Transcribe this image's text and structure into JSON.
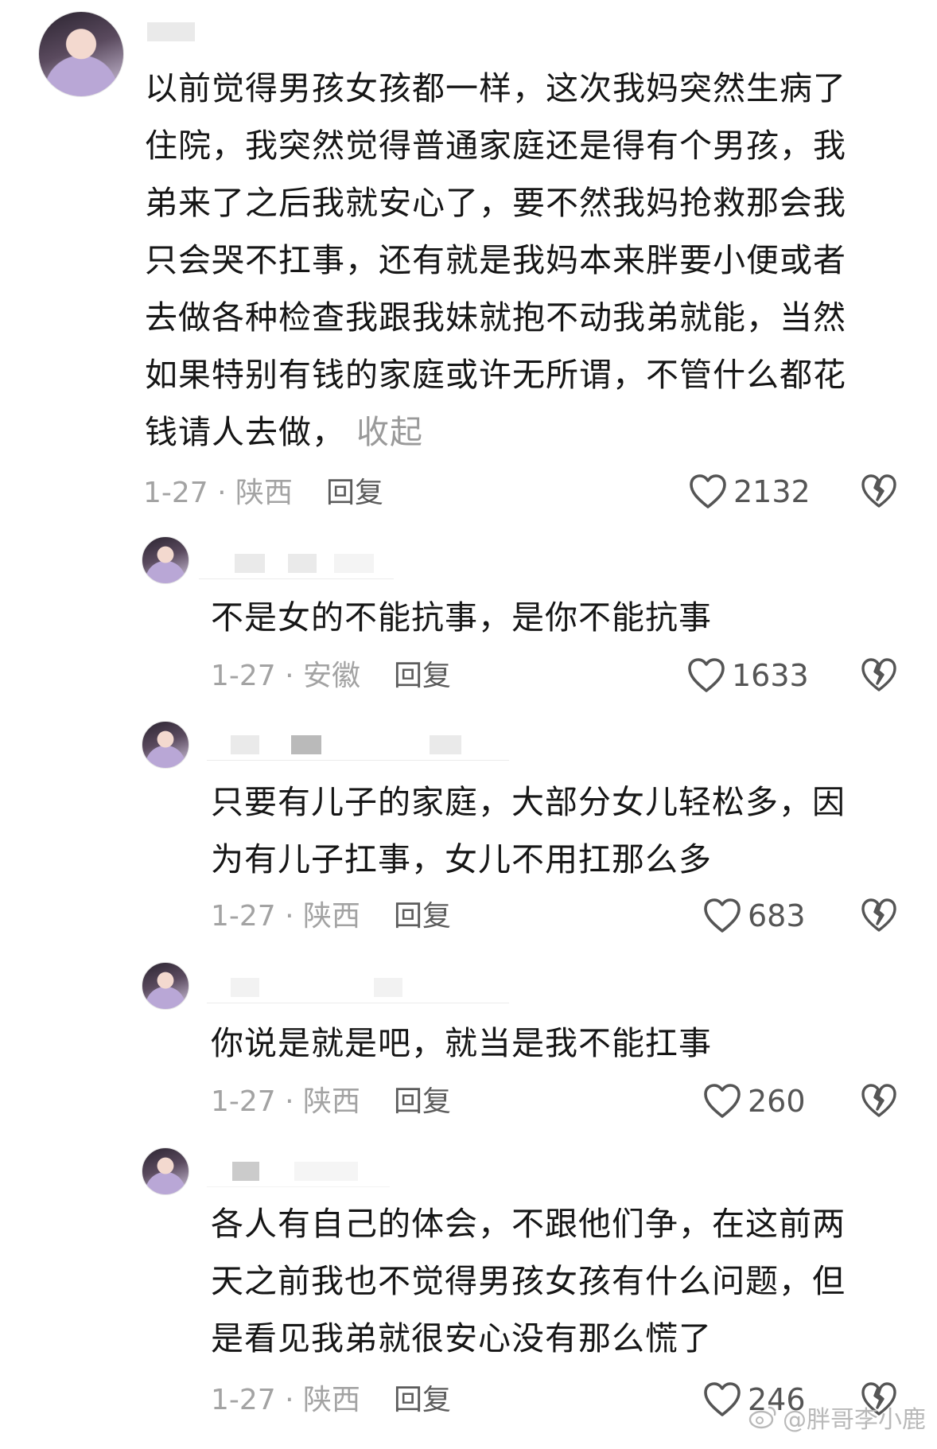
{
  "comments": [
    {
      "text": "以前觉得男孩女孩都一样，这次我妈突然生病了\n住院，我突然觉得普通家庭还是得有个男孩，我\n弟来了之后我就安心了，要不然我妈抢救那会我\n只会哭不扛事，还有就是我妈本来胖要小便或者\n去做各种检查我跟我妹就抱不动我弟就能，当然\n如果特别有钱的家庭或许无所谓，不管什么都花\n钱请人去做，",
      "collapse": "收起",
      "meta": "1-27 · 陕西",
      "reply": "回复",
      "likes": "2132"
    },
    {
      "text": "不是女的不能抗事，是你不能抗事",
      "meta": "1-27 · 安徽",
      "reply": "回复",
      "likes": "1633"
    },
    {
      "text": "只要有儿子的家庭，大部分女儿轻松多，因\n为有儿子扛事，女儿不用扛那么多",
      "meta": "1-27 · 陕西",
      "reply": "回复",
      "likes": "683"
    },
    {
      "text": "你说是就是吧，就当是我不能扛事",
      "meta": "1-27 · 陕西",
      "reply": "回复",
      "likes": "260"
    },
    {
      "text": "各人有自己的体会，不跟他们争，在这前两\n天之前我也不觉得男孩女孩有什么问题，但\n是看见我弟就很安心没有那么慌了",
      "meta": "1-27 · 陕西",
      "reply": "回复",
      "likes": "246"
    }
  ],
  "watermark": "@胖哥李小鹿",
  "icons": {
    "like": "heart-outline-icon",
    "dislike": "broken-heart-icon",
    "watermark": "weibo-logo-icon"
  },
  "colors": {
    "text": "#161616",
    "meta": "#a3a3a3",
    "reply": "#5c5c5c",
    "icon": "#555555"
  }
}
